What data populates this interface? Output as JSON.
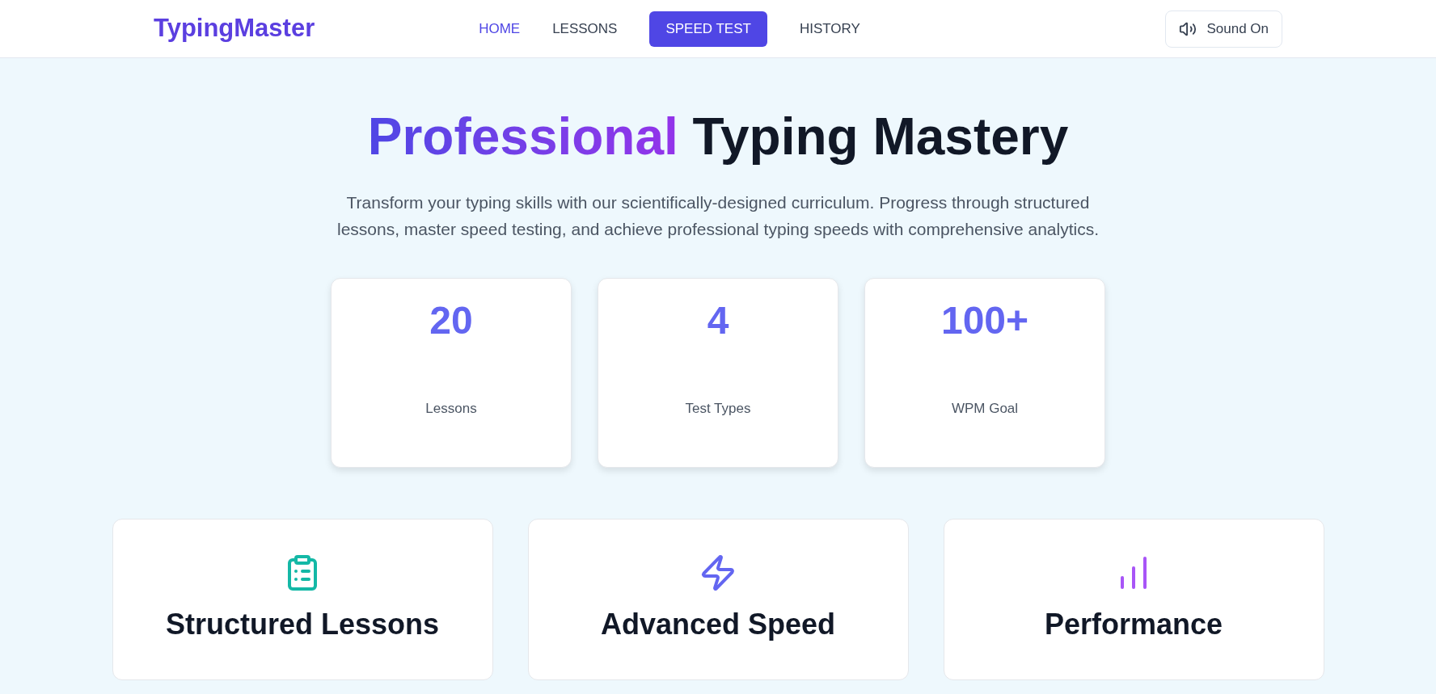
{
  "brand": "TypingMaster",
  "nav": [
    {
      "label": "HOME",
      "kind": "link",
      "selected": true
    },
    {
      "label": "LESSONS",
      "kind": "link",
      "selected": false
    },
    {
      "label": "SPEED TEST",
      "kind": "button",
      "selected": false
    },
    {
      "label": "HISTORY",
      "kind": "link",
      "selected": false
    }
  ],
  "sound_button": {
    "label": "Sound On",
    "on": true
  },
  "hero": {
    "title_highlight": "Professional",
    "title_rest": "Typing Mastery",
    "description": "Transform your typing skills with our scientifically-designed curriculum. Progress through structured lessons, master speed testing, and achieve professional typing speeds with comprehensive analytics."
  },
  "stats": [
    {
      "value": "20",
      "label": "Lessons"
    },
    {
      "value": "4",
      "label": "Test Types"
    },
    {
      "value": "100+",
      "label": "WPM Goal"
    }
  ],
  "features": [
    {
      "kind": "clipboard",
      "title": "Structured Lessons",
      "color": "#14b8a6"
    },
    {
      "kind": "bolt",
      "title": "Advanced Speed",
      "color": "#6366f1"
    },
    {
      "kind": "chart",
      "title": "Performance",
      "color": "#a855f7"
    }
  ]
}
